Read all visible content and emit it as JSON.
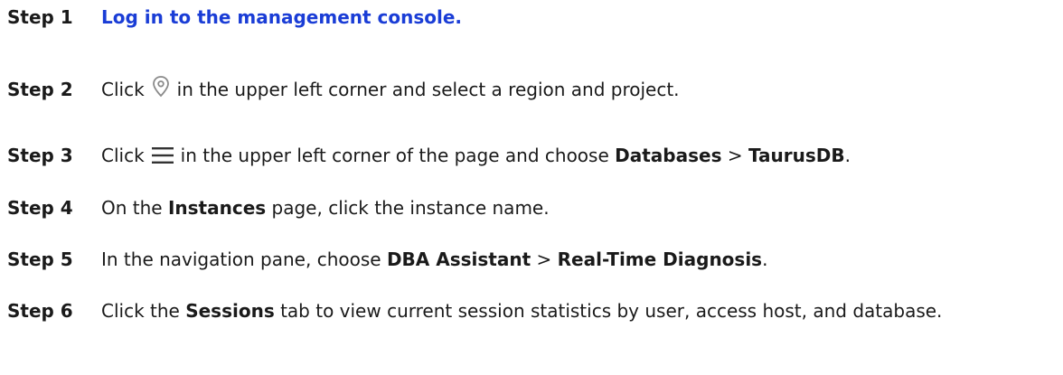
{
  "steps": [
    {
      "label": "Step 1",
      "link_text": "Log in to the management console."
    },
    {
      "label": "Step 2",
      "pre": "Click",
      "icon": "location-pin-icon",
      "post": "in the upper left corner and select a region and project."
    },
    {
      "label": "Step 3",
      "pre": "Click",
      "icon": "menu-icon",
      "post": "in the upper left corner of the page and choose",
      "bold1": "Databases",
      "sep": ">",
      "bold2": "TaurusDB",
      "end": "."
    },
    {
      "label": "Step 4",
      "pre": "On the",
      "bold1": "Instances",
      "post": "page, click the instance name."
    },
    {
      "label": "Step 5",
      "pre": "In the navigation pane, choose",
      "bold1": "DBA Assistant",
      "sep": ">",
      "bold2": "Real-Time Diagnosis",
      "end": "."
    },
    {
      "label": "Step 6",
      "pre": "Click the",
      "bold1": "Sessions",
      "post": "tab to view current session statistics by user, access host, and database."
    }
  ],
  "colors": {
    "link": "#1a3dd6",
    "text": "#1a1a1a"
  }
}
